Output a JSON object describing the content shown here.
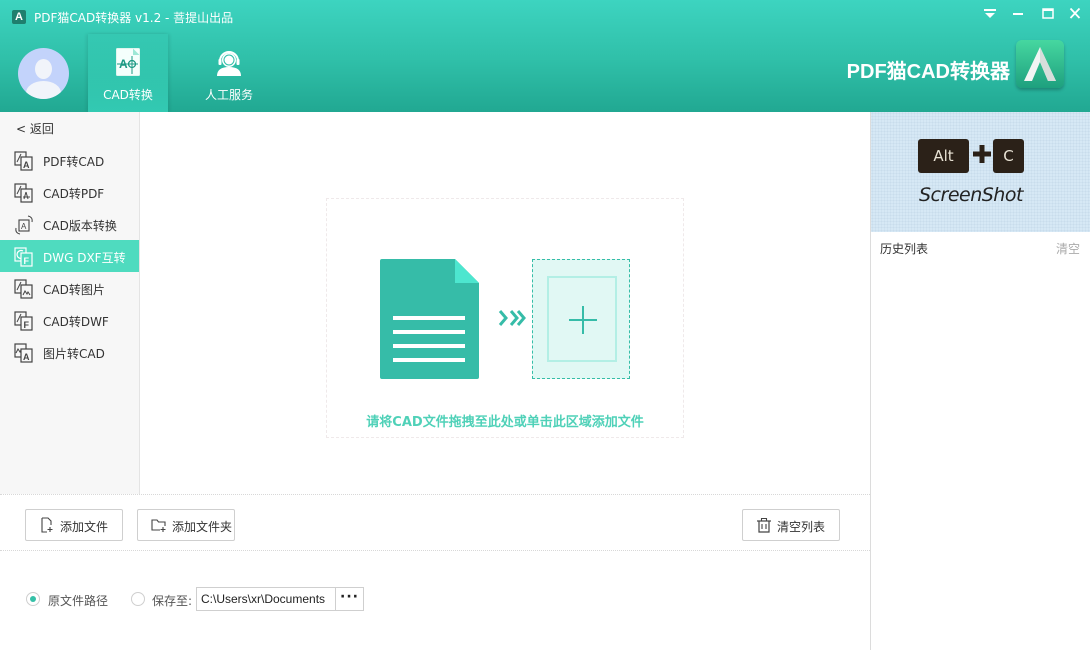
{
  "window": {
    "title": "PDF猫CAD转换器 v1.2 - 菩提山出品",
    "logo_letter": "A",
    "controls": [
      "menu-dropdown",
      "minimize",
      "maximize",
      "close"
    ]
  },
  "header": {
    "nav_tabs": [
      {
        "label": "CAD转换",
        "icon": "cad-file-icon",
        "active": true
      },
      {
        "label": "人工服务",
        "icon": "headset-support-icon",
        "active": false
      }
    ],
    "brand_text": "PDF猫CAD转换器",
    "brand_logo_letter": "A"
  },
  "sidebar": {
    "back_label": "< 返回",
    "items": [
      {
        "label": "PDF转CAD",
        "icon": "pdf-to-cad-icon",
        "active": false
      },
      {
        "label": "CAD转PDF",
        "icon": "cad-to-pdf-icon",
        "active": false
      },
      {
        "label": "CAD版本转换",
        "icon": "cad-version-icon",
        "active": false
      },
      {
        "label": "DWG DXF互转",
        "icon": "dwg-dxf-icon",
        "active": true
      },
      {
        "label": "CAD转图片",
        "icon": "cad-to-image-icon",
        "active": false
      },
      {
        "label": "CAD转DWF",
        "icon": "cad-to-dwf-icon",
        "active": false
      },
      {
        "label": "图片转CAD",
        "icon": "image-to-cad-icon",
        "active": false
      }
    ]
  },
  "dropzone": {
    "hint": "请将CAD文件拖拽至此处或单击此区域添加文件"
  },
  "toolbar": {
    "add_file_label": "添加文件",
    "add_folder_label": "添加文件夹",
    "clear_list_label": "清空列表"
  },
  "output": {
    "option_original_label": "原文件路径",
    "option_save_to_label": "保存至:",
    "selected": "original",
    "save_path": "C:\\Users\\xr\\Documents",
    "browse_label": "···"
  },
  "right_panel": {
    "banner": {
      "key1": "Alt",
      "key2": "C",
      "caption": "ScreenShot"
    },
    "history_title": "历史列表",
    "history_clear_label": "清空"
  },
  "colors": {
    "accent": "#35bda7",
    "header_top": "#3dd4c0",
    "header_bottom": "#21a892",
    "active_item": "#4fdbbf",
    "hint_text": "#4fd1b8"
  }
}
